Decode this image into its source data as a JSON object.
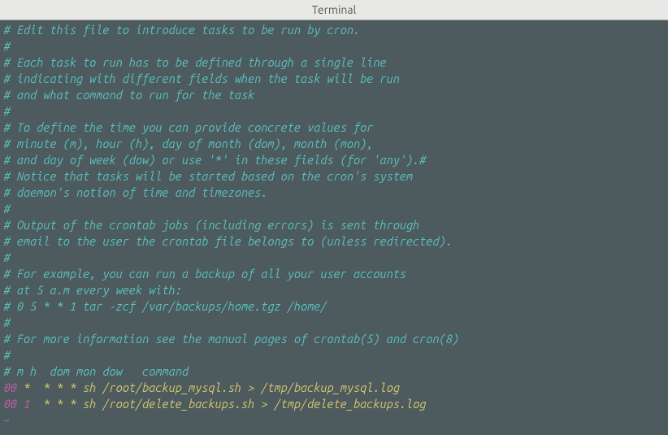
{
  "title": "Terminal",
  "lines": [
    {
      "segments": [
        {
          "cls": "teal",
          "text": "# Edit this file to introduce tasks to be run by cron."
        }
      ]
    },
    {
      "segments": [
        {
          "cls": "teal",
          "text": "#"
        }
      ]
    },
    {
      "segments": [
        {
          "cls": "teal",
          "text": "# Each task to run has to be defined through a single line"
        }
      ]
    },
    {
      "segments": [
        {
          "cls": "teal",
          "text": "# indicating with different fields when the task will be run"
        }
      ]
    },
    {
      "segments": [
        {
          "cls": "teal",
          "text": "# and what command to run for the task"
        }
      ]
    },
    {
      "segments": [
        {
          "cls": "teal",
          "text": "#"
        }
      ]
    },
    {
      "segments": [
        {
          "cls": "teal",
          "text": "# To define the time you can provide concrete values for"
        }
      ]
    },
    {
      "segments": [
        {
          "cls": "teal",
          "text": "# minute (m), hour (h), day of month (dom), month (mon),"
        }
      ]
    },
    {
      "segments": [
        {
          "cls": "teal",
          "text": "# and day of week (dow) or use '*' in these fields (for 'any').#"
        }
      ]
    },
    {
      "segments": [
        {
          "cls": "teal",
          "text": "# Notice that tasks will be started based on the cron's system"
        }
      ]
    },
    {
      "segments": [
        {
          "cls": "teal",
          "text": "# daemon's notion of time and timezones."
        }
      ]
    },
    {
      "segments": [
        {
          "cls": "teal",
          "text": "#"
        }
      ]
    },
    {
      "segments": [
        {
          "cls": "teal",
          "text": "# Output of the crontab jobs (including errors) is sent through"
        }
      ]
    },
    {
      "segments": [
        {
          "cls": "teal",
          "text": "# email to the user the crontab file belongs to (unless redirected)."
        }
      ]
    },
    {
      "segments": [
        {
          "cls": "teal",
          "text": "#"
        }
      ]
    },
    {
      "segments": [
        {
          "cls": "teal",
          "text": "# For example, you can run a backup of all your user accounts"
        }
      ]
    },
    {
      "segments": [
        {
          "cls": "teal",
          "text": "# at 5 a.m every week with:"
        }
      ]
    },
    {
      "segments": [
        {
          "cls": "teal",
          "text": "# 0 5 * * 1 tar -zcf /var/backups/home.tgz /home/"
        }
      ]
    },
    {
      "segments": [
        {
          "cls": "teal",
          "text": "#"
        }
      ]
    },
    {
      "segments": [
        {
          "cls": "teal",
          "text": "# For more information see the manual pages of crontab(5) and cron(8)"
        }
      ]
    },
    {
      "segments": [
        {
          "cls": "teal",
          "text": "#"
        }
      ]
    },
    {
      "segments": [
        {
          "cls": "teal",
          "text": "# m h  dom mon dow   command"
        }
      ]
    },
    {
      "segments": [
        {
          "cls": "magenta",
          "text": "00"
        },
        {
          "cls": "yellow",
          "text": " *  * * * sh /root/backup_mysql.sh > /tmp/backup_mysql.log"
        }
      ]
    },
    {
      "segments": [
        {
          "cls": "magenta",
          "text": "00"
        },
        {
          "cls": "yellow",
          "text": " "
        },
        {
          "cls": "magenta",
          "text": "1"
        },
        {
          "cls": "yellow",
          "text": "  * * * sh /root/delete_backups.sh > /tmp/delete_backups.log"
        }
      ]
    },
    {
      "segments": [
        {
          "cls": "tilde",
          "text": "~"
        }
      ]
    }
  ]
}
